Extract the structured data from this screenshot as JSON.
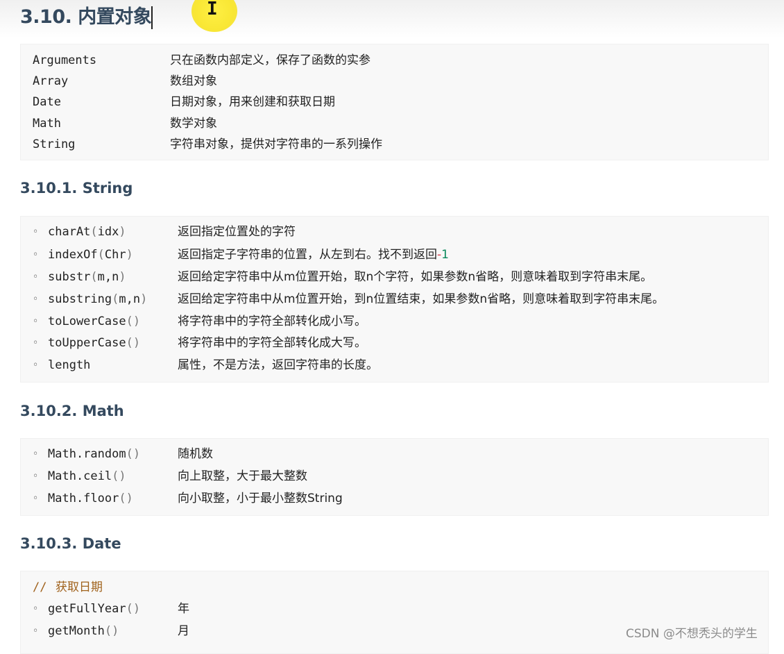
{
  "heading": "3.10. 内置对象",
  "builtin_table": [
    {
      "name": "Arguments",
      "desc": "只在函数内部定义，保存了函数的实参"
    },
    {
      "name": "Array",
      "desc": "数组对象"
    },
    {
      "name": "Date",
      "desc": "日期对象，用来创建和获取日期"
    },
    {
      "name": "Math",
      "desc": "数学对象"
    },
    {
      "name": "String",
      "desc": "字符串对象，提供对字符串的一系列操作"
    }
  ],
  "string_section": {
    "title": "3.10.1. String",
    "items": [
      {
        "fn": "charAt",
        "args": "idx",
        "desc": "返回指定位置处的字符"
      },
      {
        "fn": "indexOf",
        "args": "Chr",
        "desc": "返回指定子字符串的位置，从左到右。找不到返回",
        "minus": "-",
        "num": "1"
      },
      {
        "fn": "substr",
        "args": "m,n",
        "desc": "返回给定字符串中从m位置开始，取n个字符，如果参数n省略，则意味着取到字符串末尾。"
      },
      {
        "fn": "substring",
        "args": "m,n",
        "desc": "返回给定字符串中从m位置开始，到n位置结束，如果参数n省略，则意味着取到字符串末尾。"
      },
      {
        "fn": "toLowerCase",
        "args": "",
        "desc": "将字符串中的字符全部转化成小写。"
      },
      {
        "fn": "toUpperCase",
        "args": "",
        "desc": "将字符串中的字符全部转化成大写。"
      },
      {
        "fn": "length",
        "args": null,
        "desc": "属性，不是方法，返回字符串的长度。"
      }
    ]
  },
  "math_section": {
    "title": "3.10.2. Math",
    "items": [
      {
        "fn": "Math.random",
        "desc": "随机数"
      },
      {
        "fn": "Math.ceil",
        "desc": "向上取整，大于最大整数"
      },
      {
        "fn": "Math.floor",
        "desc": "向小取整，小于最小整数String"
      }
    ]
  },
  "date_section": {
    "title": "3.10.3. Date",
    "comment_slashes": "//",
    "comment_text": "获取日期",
    "items": [
      {
        "fn": "getFullYear",
        "desc": "年"
      },
      {
        "fn": "getMonth",
        "desc": "月"
      }
    ]
  },
  "watermark": "CSDN @不想秃头的学生",
  "colors": {
    "heading": "#34495e",
    "code_bg": "#f8f8f8",
    "comment": "#a0621c",
    "number": "#09885a",
    "cursor_highlight": "#f9e62a"
  },
  "icons": {
    "cursor": "text-cursor-icon",
    "bullet": "hollow-circle-bullet"
  }
}
